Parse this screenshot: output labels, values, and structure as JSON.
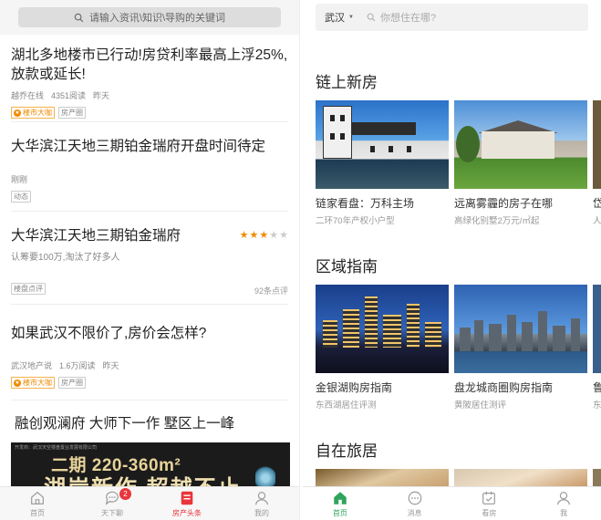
{
  "left": {
    "search_placeholder": "请输入资讯\\知识\\导购的关键词",
    "articles": [
      {
        "title": "湖北多地楼市已行动!房贷利率最高上浮25%,放款或延长!",
        "source": "越乔在线",
        "reads": "4351阅读",
        "time": "昨天",
        "tags": [
          "楼市大咖",
          "房产圈"
        ]
      },
      {
        "title": "大华滨江天地三期铂金瑞府开盘时间待定",
        "time": "刚刚",
        "tags": [
          "动态"
        ]
      },
      {
        "title": "大华滨江天地三期铂金瑞府",
        "desc": "认筹要100万,淘汰了好多人",
        "rating_stars": 3,
        "rating_max": 5,
        "tags": [
          "楼盘点评"
        ],
        "review_count": "92条点评"
      },
      {
        "title": "如果武汉不限价了,房价会怎样?",
        "source": "武汉地产说",
        "reads": "1.6万阅读",
        "time": "昨天",
        "tags": [
          "楼市大咖",
          "房产圈"
        ]
      },
      {
        "title": "融创观澜府 大师下一作 墅区上一峰"
      }
    ],
    "banner": {
      "small": "开发商：武汉天空楼盘置业发展有限公司",
      "line1": "二期 220-360m²",
      "line2": "湖岸新作 超越不止"
    },
    "tabbar": [
      {
        "label": "首页",
        "icon": "home-icon"
      },
      {
        "label": "天下聊",
        "icon": "chat-icon",
        "badge": "2"
      },
      {
        "label": "房产头条",
        "icon": "news-icon",
        "active": true
      },
      {
        "label": "我的",
        "icon": "user-icon"
      }
    ],
    "active_color": "#e8363b"
  },
  "right": {
    "city": "武汉",
    "search_placeholder": "你想住在哪?",
    "sections": [
      {
        "title": "链上新房",
        "cards": [
          {
            "title": "链家看盘：万科主场",
            "sub": "二环70年产权小户型"
          },
          {
            "title": "远离雾霾的房子在哪",
            "sub": "高绿化别墅2万元/㎡起"
          },
          {
            "title": "岱",
            "sub": "人"
          }
        ]
      },
      {
        "title": "区域指南",
        "cards": [
          {
            "title": "金银湖购房指南",
            "sub": "东西湖居住评测"
          },
          {
            "title": "盘龙城商圈购房指南",
            "sub": "黄陂居住测评"
          },
          {
            "title": "鲁",
            "sub": "东"
          }
        ]
      },
      {
        "title": "自在旅居",
        "cards": []
      }
    ],
    "tabbar": [
      {
        "label": "首页",
        "icon": "home-icon",
        "active": true
      },
      {
        "label": "消息",
        "icon": "message-icon"
      },
      {
        "label": "看房",
        "icon": "calendar-icon"
      },
      {
        "label": "我",
        "icon": "user-icon"
      }
    ],
    "active_color": "#2fa45c"
  }
}
